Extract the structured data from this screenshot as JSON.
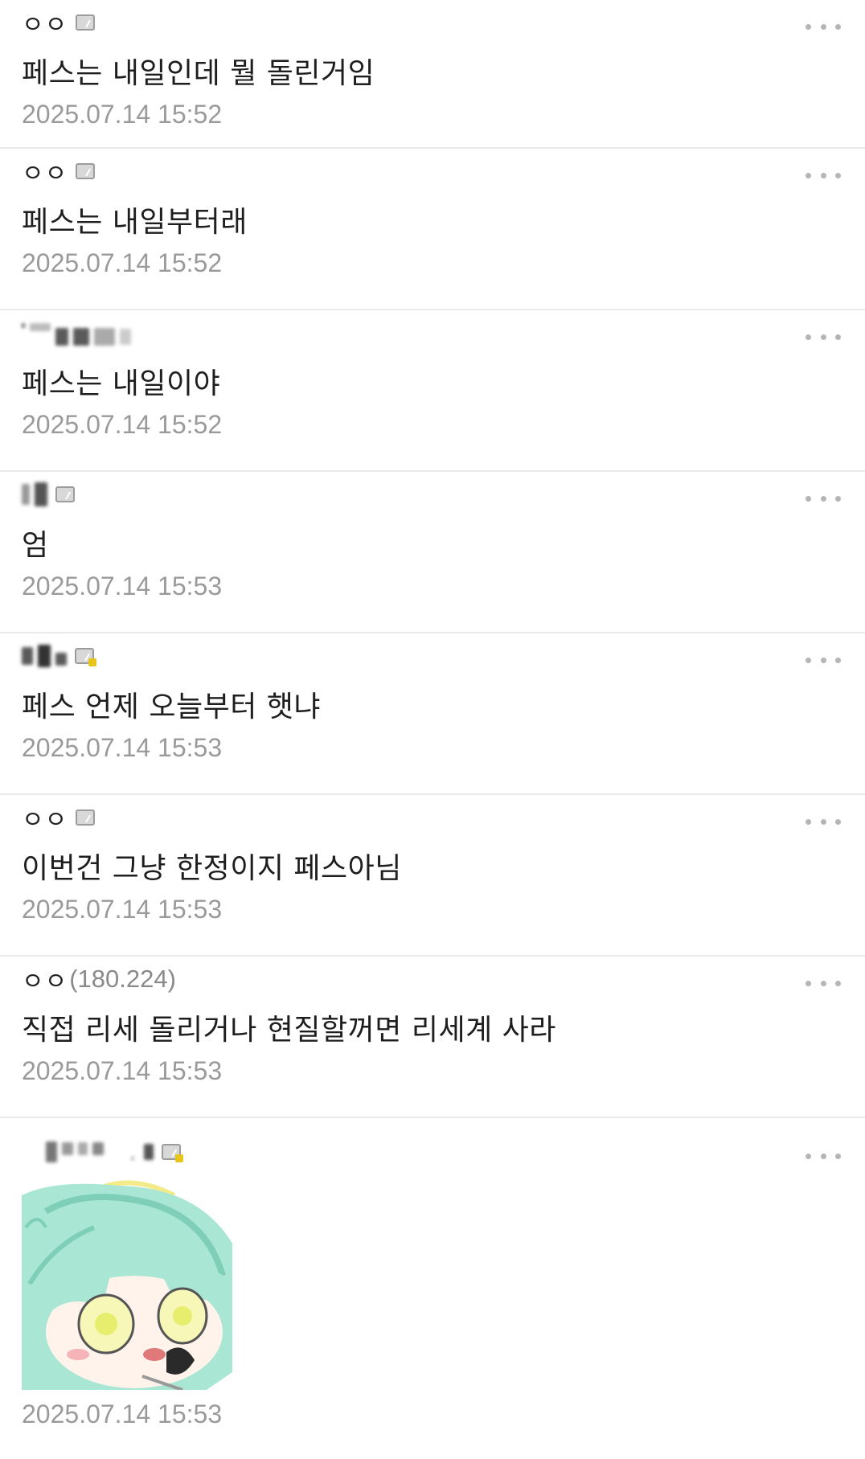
{
  "comments": [
    {
      "nick": "ㅇㅇ",
      "text": "페스는 내일인데 뭘 돌린거임",
      "time": "2025.07.14 15:52"
    },
    {
      "nick": "ㅇㅇ",
      "text": "페스는 내일부터래",
      "time": "2025.07.14 15:52"
    },
    {
      "text": "페스는 내일이야",
      "time": "2025.07.14 15:52"
    },
    {
      "text": "엄",
      "time": "2025.07.14 15:53"
    },
    {
      "text": "페스 언제 오늘부터 햇냐",
      "time": "2025.07.14 15:53"
    },
    {
      "nick": "ㅇㅇ",
      "text": "이번건 그냥 한정이지 페스아님",
      "time": "2025.07.14 15:53"
    },
    {
      "nick": "ㅇㅇ",
      "ip": "(180.224)",
      "text": "직접 리세 돌리거나 현질할꺼면 리세계 사라",
      "time": "2025.07.14 15:53"
    },
    {
      "time": "2025.07.14 15:53"
    }
  ],
  "icons": {
    "more": "more-dots-icon",
    "badge": "user-badge-icon",
    "sticker": "anime-girl-sticker"
  },
  "colors": {
    "text": "#1e1e1e",
    "time": "#9a9a9a",
    "divider": "#ebebeb",
    "sticker_hair": "#9fe3cf"
  }
}
